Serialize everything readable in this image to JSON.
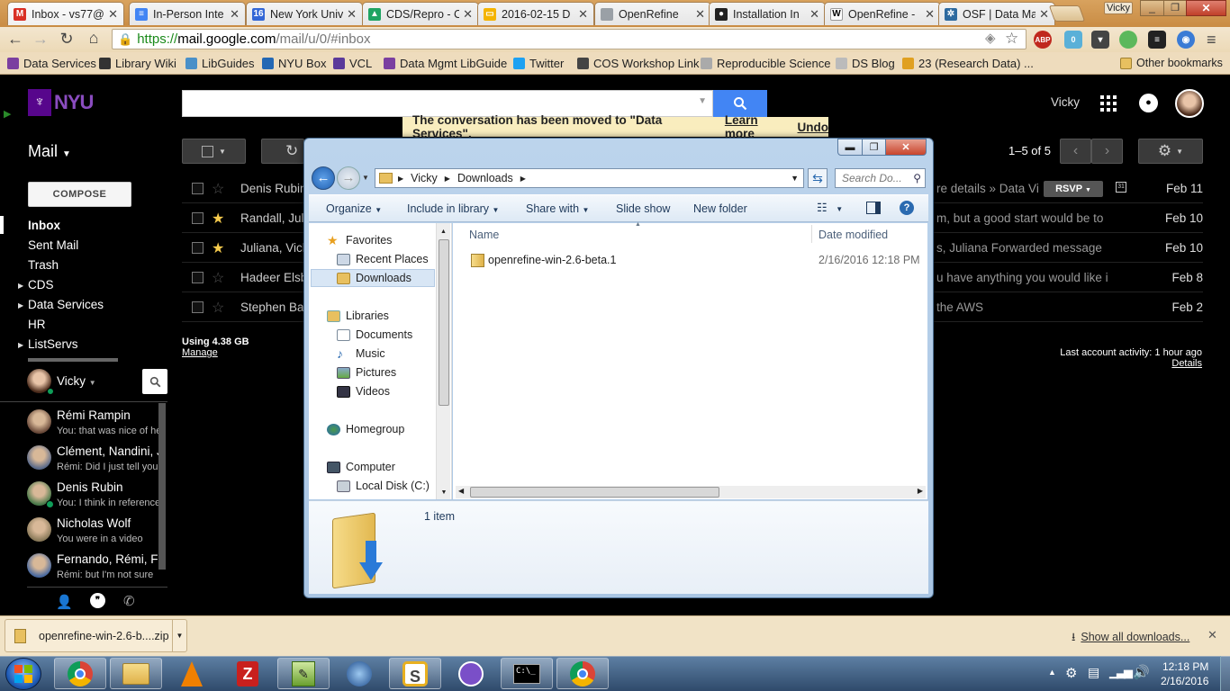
{
  "browser": {
    "tabs": [
      {
        "title": "Inbox - vs77@",
        "icon": "gmail-icon",
        "color": "#d93025",
        "glyph": "M"
      },
      {
        "title": "In-Person Inte",
        "icon": "docs-icon",
        "color": "#4285f4",
        "glyph": "≡"
      },
      {
        "title": "New York Univ",
        "icon": "calendar-icon",
        "color": "#3367d6",
        "glyph": "16"
      },
      {
        "title": "CDS/Repro - C",
        "icon": "drive-icon",
        "color": "#1fa463",
        "glyph": "▲"
      },
      {
        "title": "2016-02-15 D",
        "icon": "slides-icon",
        "color": "#f4b400",
        "glyph": "▭"
      },
      {
        "title": "OpenRefine",
        "icon": "page-icon",
        "color": "#9aa0a6",
        "glyph": ""
      },
      {
        "title": "Installation In",
        "icon": "github-icon",
        "color": "#222222",
        "glyph": "●"
      },
      {
        "title": "OpenRefine -",
        "icon": "wikipedia-icon",
        "color": "#ffffff",
        "glyph": "W"
      },
      {
        "title": "OSF | Data Ma",
        "icon": "osf-icon",
        "color": "#2d6a9f",
        "glyph": "✲"
      }
    ],
    "profile_name": "Vicky",
    "url": {
      "scheme": "https://",
      "domain": "mail.google.com",
      "path": "/mail/u/0/#inbox"
    },
    "extensions": {
      "abp": "ABP",
      "badge": "0"
    },
    "bookmarks": [
      {
        "label": "Data Services",
        "color": "#7b3fa0"
      },
      {
        "label": "Library Wiki",
        "color": "#333333"
      },
      {
        "label": "LibGuides",
        "color": "#4a90c8"
      },
      {
        "label": "NYU Box",
        "color": "#2468b4"
      },
      {
        "label": "VCL",
        "color": "#5b3a9a"
      },
      {
        "label": "Data Mgmt LibGuide",
        "color": "#7b3fa0"
      },
      {
        "label": "Twitter",
        "color": "#1da1f2"
      },
      {
        "label": "COS Workshop Link",
        "color": "#444444"
      },
      {
        "label": "Reproducible Science",
        "color": "#aaaaaa"
      },
      {
        "label": "DS Blog",
        "color": "#bbbbbb"
      },
      {
        "label": "23 (Research Data) ...",
        "color": "#e0a020"
      }
    ],
    "other_bookmarks": "Other bookmarks"
  },
  "gmail": {
    "logo": "NYU",
    "user": "Vicky",
    "notice": {
      "text": "The conversation has been moved to \"Data Services\".",
      "learn_more": "Learn more",
      "undo": "Undo"
    },
    "mail_label": "Mail",
    "compose": "COMPOSE",
    "pagination": "1–5 of 5",
    "nav": [
      {
        "label": "Inbox",
        "bold": true,
        "arrow": false
      },
      {
        "label": "Sent Mail",
        "arrow": false
      },
      {
        "label": "Trash",
        "arrow": false
      },
      {
        "label": "CDS",
        "arrow": true
      },
      {
        "label": "Data Services",
        "arrow": true
      },
      {
        "label": "HR",
        "arrow": false
      },
      {
        "label": "ListServs",
        "arrow": true
      }
    ],
    "emails": [
      {
        "sender": "Denis Rubin",
        "starred": false,
        "snippet": "re details » Data Vi",
        "rsvp": "RSVP",
        "date": "Feb 11"
      },
      {
        "sender": "Randall, Juli",
        "starred": true,
        "snippet": "m, but a good start would be to h",
        "date": "Feb 10"
      },
      {
        "sender": "Juliana, Vich",
        "starred": true,
        "snippet": "s, Juliana Forwarded message",
        "date": "Feb 10"
      },
      {
        "sender": "Hadeer Elsb",
        "starred": false,
        "snippet": "u have anything you would like inc",
        "date": "Feb 8"
      },
      {
        "sender": "Stephen Ba",
        "starred": false,
        "snippet": "the AWS",
        "date": "Feb 2"
      }
    ],
    "storage": {
      "using": "Using 4.38 GB",
      "manage": "Manage"
    },
    "activity": {
      "text": "Last account activity: 1 hour ago",
      "details": "Details"
    },
    "chat": {
      "me": "Vicky",
      "contacts": [
        {
          "name": "Rémi Rampin",
          "message": "You: that was nice of he",
          "online": false
        },
        {
          "name": "Clément, Nandini, J",
          "message": "Rémi: Did I just tell you",
          "online": false
        },
        {
          "name": "Denis Rubin",
          "message": "You: I think in reference",
          "online": true
        },
        {
          "name": "Nicholas Wolf",
          "message": "You were in a video",
          "online": false
        },
        {
          "name": "Fernando, Rémi, Fe",
          "message": "Rémi: but I'm not sure",
          "online": false
        }
      ]
    }
  },
  "explorer": {
    "breadcrumb": [
      "Vicky",
      "Downloads"
    ],
    "search_placeholder": "Search Do...",
    "commands": {
      "organize": "Organize",
      "include": "Include in library",
      "share": "Share with",
      "slideshow": "Slide show",
      "new_folder": "New folder"
    },
    "nav": {
      "favorites": "Favorites",
      "recent": "Recent Places",
      "downloads": "Downloads",
      "libraries": "Libraries",
      "documents": "Documents",
      "music": "Music",
      "pictures": "Pictures",
      "videos": "Videos",
      "homegroup": "Homegroup",
      "computer": "Computer",
      "local_disk": "Local Disk (C:)"
    },
    "columns": {
      "name": "Name",
      "date": "Date modified"
    },
    "files": [
      {
        "name": "openrefine-win-2.6-beta.1",
        "date": "2/16/2016 12:18 PM"
      }
    ],
    "item_count": "1 item"
  },
  "downloads": {
    "file": "openrefine-win-2.6-b....zip",
    "show_all": "Show all downloads..."
  },
  "taskbar": {
    "time": "12:18 PM",
    "date": "2/16/2016"
  }
}
